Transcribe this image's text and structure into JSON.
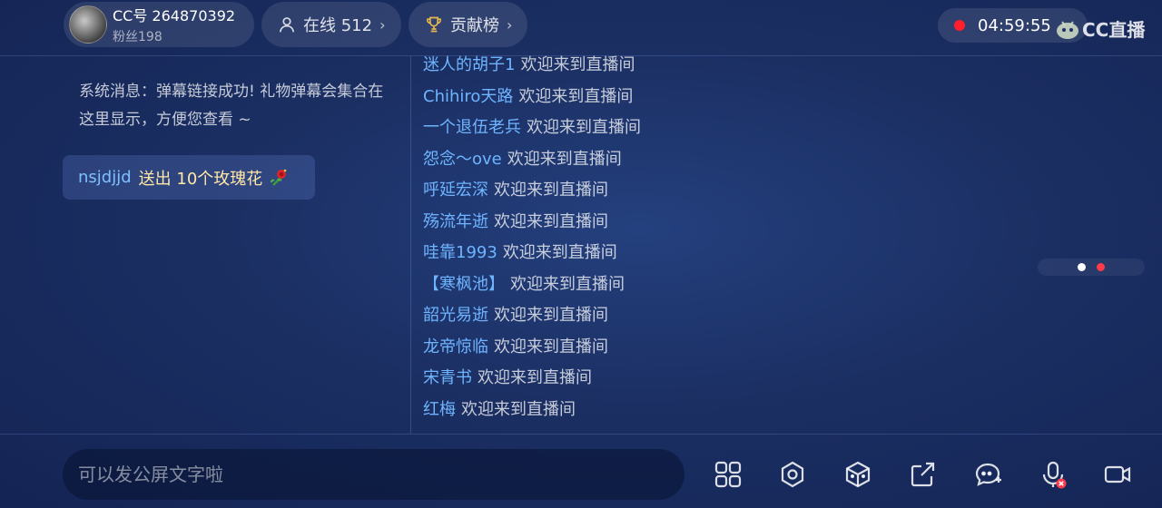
{
  "header": {
    "cc_number": "CC号 264870392",
    "fans": "粉丝198",
    "online": "在线 512",
    "rank": "贡献榜",
    "chevron": "›",
    "timer": "04:59:55",
    "logo_text": "CC直播"
  },
  "system_message": "系统消息：弹幕链接成功! 礼物弹幕会集合在这里显示，方便您查看 ~",
  "gift": {
    "user": "nsjdjjd",
    "text": "送出 10个玫瑰花"
  },
  "welcome": [
    {
      "name": "迷人的胡子1",
      "msg": "欢迎来到直播间"
    },
    {
      "name": "Chihiro天路",
      "msg": "欢迎来到直播间"
    },
    {
      "name": "一个退伍老兵",
      "msg": "欢迎来到直播间"
    },
    {
      "name": "怨念～ove",
      "msg": "欢迎来到直播间"
    },
    {
      "name": "呼延宏深",
      "msg": "欢迎来到直播间"
    },
    {
      "name": "殇流年逝",
      "msg": "欢迎来到直播间"
    },
    {
      "name": "哇靠1993",
      "msg": "欢迎来到直播间"
    },
    {
      "name": "【寒枫池】",
      "msg": "欢迎来到直播间"
    },
    {
      "name": "韶光易逝",
      "msg": "欢迎来到直播间"
    },
    {
      "name": "龙帝惊临",
      "msg": "欢迎来到直播间"
    },
    {
      "name": "宋青书",
      "msg": "欢迎来到直播间"
    },
    {
      "name": "红梅",
      "msg": "欢迎来到直播间"
    }
  ],
  "chat": {
    "placeholder": "可以发公屏文字啦"
  },
  "colors": {
    "accent_name": "#6fb4ff",
    "record_dot": "#ff1e2c",
    "gift_text": "#ffe7a6"
  },
  "icons": [
    "user-icon",
    "trophy-icon",
    "record-dot-icon",
    "cc-logo-icon",
    "rose-icon",
    "grid-icon",
    "settings-icon",
    "cube-icon",
    "share-icon",
    "chat-add-icon",
    "mic-muted-icon",
    "camera-icon"
  ]
}
